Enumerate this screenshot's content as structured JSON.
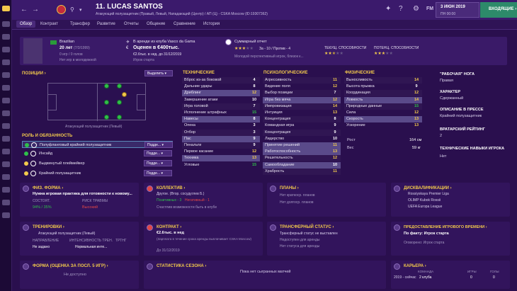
{
  "header": {
    "player_number": "11.",
    "player_name": "LUCAS SANTOS",
    "subtitle": "Атакующий полузащитник (Правый, Левый, Нападающий (Центр) / АП (Ц) - CSKA Moscow (ID:19307362)",
    "date": "3 ИЮН 2019",
    "weekday": "ПН 00:00",
    "inbox_label": "ВХОДЯЩИЕ",
    "fm_label": "FM"
  },
  "tabs": [
    "Обзор",
    "Контракт",
    "Трансфер",
    "Развитие",
    "Отчеты",
    "Общение",
    "Сравнение",
    "История"
  ],
  "profile": {
    "nationality": "Brazilian",
    "age": "20 лет",
    "dob": "(7/3/1999)",
    "caps": "0 игр / 0 голов",
    "youth": "Нет игр в молодежной",
    "loan_text": "В аренде из клуба Vasco da Gama",
    "value": "Оценен в €400тыс.",
    "wage": "€2.6тыс. в нед. до 31/12/2019",
    "status": "Игрок старта",
    "report_title": "Суммарный отчет",
    "report_pros": "За - 10 / Против - 4",
    "report_note": "Молодой перспективный игрок, близок к...",
    "current_ability": "ТЕКУЩ. СПОСОБНОСТИ",
    "potential_ability": "ПОТЕНЦ. СПОСОБНОСТИ",
    "report_stars": 3,
    "current_stars": 2.5,
    "potential_stars": 3
  },
  "positions": {
    "title": "ПОЗИЦИИ",
    "select_label": "Выделить",
    "pitch_caption": "Атакующий полузащитник (Левый)"
  },
  "roles": {
    "title": "РОЛЬ И ОБЯЗАННОСТЬ",
    "items": [
      {
        "label": "Полуфланговый крайний полузащитник",
        "duty": "Подде..."
      },
      {
        "label": "Инсайд",
        "duty": "Подде..."
      },
      {
        "label": "Выдвинутый плеймейкер",
        "duty": "Подде..."
      },
      {
        "label": "Крайний полузащитник",
        "duty": "Подде..."
      }
    ]
  },
  "technical": {
    "title": "ТЕХНИЧЕСКИЕ",
    "rows": [
      {
        "name": "Вброс из-за боковой",
        "value": "4"
      },
      {
        "name": "Дальние удары",
        "value": "8"
      },
      {
        "name": "Дриблинг",
        "value": "12"
      },
      {
        "name": "Завершение атаки",
        "value": "10"
      },
      {
        "name": "Игра головой",
        "value": "7"
      },
      {
        "name": "Исполнение штрафных",
        "value": "15"
      },
      {
        "name": "Навесы",
        "value": "8"
      },
      {
        "name": "Опека",
        "value": "3"
      },
      {
        "name": "Отбор",
        "value": "3"
      },
      {
        "name": "Пас",
        "value": "9"
      },
      {
        "name": "Пенальти",
        "value": "9"
      },
      {
        "name": "Первое касание",
        "value": "12"
      },
      {
        "name": "Техника",
        "value": "13"
      },
      {
        "name": "Угловые",
        "value": "15"
      }
    ]
  },
  "mental": {
    "title": "ПСИХОЛОГИЧЕСКИЕ",
    "rows": [
      {
        "name": "Агрессивность",
        "value": "11"
      },
      {
        "name": "Видение поля",
        "value": "12"
      },
      {
        "name": "Выбор позиции",
        "value": "7"
      },
      {
        "name": "Игра без мяча",
        "value": "12"
      },
      {
        "name": "Импровизация",
        "value": "14"
      },
      {
        "name": "Интуиция",
        "value": "13"
      },
      {
        "name": "Концентрация",
        "value": "8"
      },
      {
        "name": "Командная игра",
        "value": "9"
      },
      {
        "name": "Концентрация",
        "value": "9"
      },
      {
        "name": "Лидерство",
        "value": "10"
      },
      {
        "name": "Принятие решений",
        "value": "11"
      },
      {
        "name": "Работоспособность",
        "value": "13"
      },
      {
        "name": "Решительность",
        "value": "12"
      },
      {
        "name": "Самообладание",
        "value": "10"
      },
      {
        "name": "Храбрость",
        "value": "11"
      }
    ]
  },
  "physical": {
    "title": "ФИЗИЧЕСКИЕ",
    "rows": [
      {
        "name": "Выносливость",
        "value": "14"
      },
      {
        "name": "Высота прыжка",
        "value": "9"
      },
      {
        "name": "Координация",
        "value": "12"
      },
      {
        "name": "Ловкость",
        "value": "14"
      },
      {
        "name": "Природные данные",
        "value": "15"
      },
      {
        "name": "Сила",
        "value": "12"
      },
      {
        "name": "Скорость",
        "value": "13"
      },
      {
        "name": "Ускорение",
        "value": "13"
      }
    ],
    "height_label": "Рост",
    "height": "164 см",
    "weight_label": "Вес",
    "weight": "59 кг"
  },
  "side": {
    "foot_title": "\"РАБОЧАЯ\" НОГА",
    "foot": "Правая",
    "character_title": "ХАРАКТЕР",
    "character": "Сдержанный",
    "desc_title": "ОПИСАНИЕ В ПРЕССЕ",
    "desc": "Крайний полузащитник",
    "gk_title": "ВРАТАРСКИЙ РЕЙТИНГ",
    "gk": "2",
    "skills_title": "ТЕХНИЧЕСКИЕ НАВЫКИ ИГРОКА",
    "skills": "Нет"
  },
  "fitness": {
    "title": "ФИЗ. ФОРМА",
    "text": "Нужна игровая практика для готовности к новому...",
    "cond_label": "СОСТОЯТ.",
    "cond": "94% / 35%",
    "risk_label": "РИСК ТРАВМЫ",
    "risk": "Высокий"
  },
  "team": {
    "title": "КОЛЛЕКТИВ",
    "line1": "Другое. (Втор. сосудуглев Б.)",
    "line2a": "Позитивных - 3",
    "line2b": "Негативный - 1",
    "line3": "Счастлив возможности быть в клубе"
  },
  "plans": {
    "title": "ПЛАНЫ",
    "line1": "Нет краткоср. планов",
    "line2": "Нет долгоср. планов"
  },
  "competitions": {
    "title": "ДИСКВАЛИФИКАЦИИ",
    "items": [
      "Rossiyskaya Premier Liga",
      "OLIMP Kubok Rossii",
      "UEFA Europa League"
    ]
  },
  "training": {
    "title": "ТРЕНИРОВКИ",
    "role": "Атакующий полузащитник (Левый)",
    "dir_label": "НАПРАВЛЕНИЕ",
    "dir": "Не задано",
    "int_label": "ИНТЕНСИВНОСТЬ ТРЕН.",
    "int": "Нормальная инте...",
    "extra_label": "ТРТНГ"
  },
  "contract": {
    "title": "КОНТРАКТ",
    "wage": "€2.6тыс. в нед",
    "note": "(Зарплата в течение срока аренды выплачивает CSKA Moscow)",
    "expires": "До 31/12/2019"
  },
  "transfer": {
    "title": "ТРАНСФЕРНЫЙ СТАТУС",
    "line1": "Трансферный статус не выставлен",
    "line2": "Недоступен для аренды",
    "line3": "Нет статуса для аренды"
  },
  "playing_time": {
    "title": "ПРЕДОСТАВЛЕНИЕ ИГРОВОГО ВРЕМЕНИ",
    "value": "По факту: Игрок старта",
    "line2": "Оговорено: Игрок старта"
  },
  "form": {
    "title": "ФОРМА (ОЦЕНКА ЗА ПОСЛ. 5 ИГР)",
    "text": "Не доступно"
  },
  "season": {
    "title": "СТАТИСТИКА СЕЗОНА",
    "text": "Пока нет сыгранных матчей"
  },
  "career": {
    "title": "КАРЬЕРА",
    "col1": "КОМАНДА",
    "col2": "ИГРЫ",
    "col3": "ГОЛЫ",
    "row_label": "2019 - сейчас",
    "row_team": "2 клуба",
    "row_games": "0",
    "row_goals": "0"
  },
  "colors": {
    "accent": "#f2c94c",
    "background": "#2a0f4e",
    "panel": "#32145c",
    "green": "#2fbf4a",
    "red": "#e04646"
  }
}
